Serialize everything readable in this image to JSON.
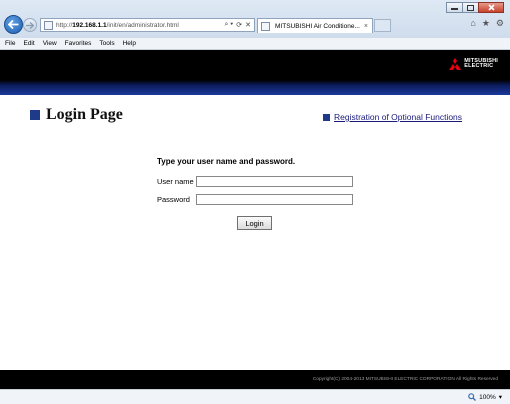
{
  "browser": {
    "url_prefix": "http://",
    "url_host": "192.168.1.1",
    "url_path": "/init/en/administrator.html",
    "tab_title": "MITSUBISHI Air Conditione...",
    "tab_close": "×",
    "menu": [
      "File",
      "Edit",
      "View",
      "Favorites",
      "Tools",
      "Help"
    ],
    "search_symbol": "⌕ ▾",
    "refresh_symbol": "⟳",
    "stop_symbol": "✕",
    "home_symbol": "⌂",
    "star_symbol": "★",
    "gear_symbol": "⚙"
  },
  "header": {
    "logo_line1": "MITSUBISHI",
    "logo_line2": "ELECTRIC",
    "logo_color": "#e60012",
    "band_color": "#1a3a9c"
  },
  "page": {
    "title": "Login Page",
    "optional_link": "Registration of Optional Functions",
    "prompt": "Type your user name and password.",
    "username_label": "User name",
    "username_value": "",
    "password_label": "Password",
    "password_value": "",
    "login_button": "Login"
  },
  "footer": {
    "copyright": "Copyright(C) 2004-2013 MITSUBISHI ELECTRIC CORPORATION All Rights Reserved"
  },
  "status": {
    "zoom": "100%",
    "zoom_arrow": "▾",
    "zoom_icon": "magnifier-icon"
  }
}
